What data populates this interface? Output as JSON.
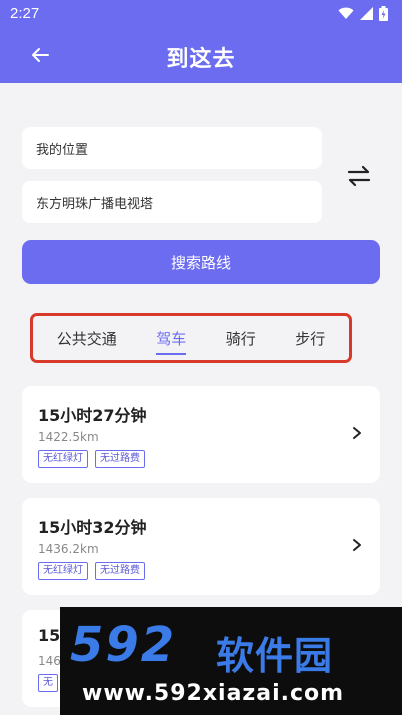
{
  "status_bar": {
    "time": "2:27"
  },
  "header": {
    "title": "到这去"
  },
  "route": {
    "origin": "我的位置",
    "destination": "东方明珠广播电视塔",
    "search_label": "搜索路线"
  },
  "modes": [
    {
      "label": "公共交通",
      "active": false
    },
    {
      "label": "驾车",
      "active": true
    },
    {
      "label": "骑行",
      "active": false
    },
    {
      "label": "步行",
      "active": false
    }
  ],
  "results": [
    {
      "duration": "15小时27分钟",
      "distance": "1422.5km",
      "tags": [
        "无红绿灯",
        "无过路费"
      ]
    },
    {
      "duration": "15小时32分钟",
      "distance": "1436.2km",
      "tags": [
        "无红绿灯",
        "无过路费"
      ]
    },
    {
      "duration": "15",
      "distance": "146",
      "tags": [
        "无"
      ]
    }
  ],
  "watermark": {
    "logo": "592",
    "brand": "软件园",
    "url": "www.592xiazai.com"
  },
  "colors": {
    "primary": "#6c6cf0",
    "highlight_border": "#d8392b",
    "background": "#f3f3f5"
  }
}
